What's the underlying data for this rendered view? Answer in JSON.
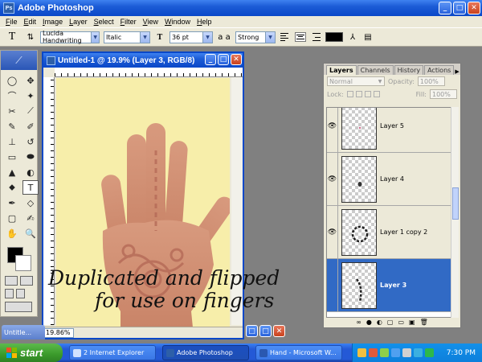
{
  "app": {
    "title": "Adobe Photoshop",
    "logo": "Ps"
  },
  "window_controls": {
    "minimize": "_",
    "restore": "□",
    "close": "✕"
  },
  "menu": [
    "File",
    "Edit",
    "Image",
    "Layer",
    "Select",
    "Filter",
    "View",
    "Window",
    "Help"
  ],
  "options_bar": {
    "tool_glyph": "T",
    "font_family": "Lucida Handwriting",
    "font_style": "Italic",
    "font_size": "36 pt",
    "aa_label": "a a",
    "antialias": "Strong",
    "color": "#000000"
  },
  "toolbox": {
    "tools": [
      "◯",
      "✥",
      "⌒",
      "✦",
      "✂",
      "⟋",
      "✎",
      "✐",
      "⊥",
      "↺",
      "▭",
      "⬬",
      "▲",
      "◐",
      "⬥",
      "T",
      "✒",
      "◇",
      "▢",
      "✍",
      "✋",
      "🔍"
    ],
    "active_tool_index": 15
  },
  "document": {
    "title": "Untitled-1 @ 19.9% (Layer 3, RGB/8)",
    "zoom": "19.86%",
    "canvas_color": "#f7eeaa"
  },
  "layers_panel": {
    "tabs": [
      "Layers",
      "Channels",
      "History",
      "Actions"
    ],
    "active_tab": "Layers",
    "blend_mode": "Normal",
    "opacity_label": "Opacity:",
    "opacity": "100%",
    "lock_label": "Lock:",
    "fill_label": "Fill:",
    "fill": "100%",
    "layers": [
      {
        "name": "Layer 5",
        "visible": true,
        "selected": false
      },
      {
        "name": "Layer 4",
        "visible": true,
        "selected": false
      },
      {
        "name": "Layer 1 copy 2",
        "visible": true,
        "selected": false
      },
      {
        "name": "Layer 3",
        "visible": false,
        "selected": true
      }
    ],
    "footer_icons": [
      "∞",
      "●",
      "◐",
      "▢",
      "▭",
      "▣",
      "🗑"
    ]
  },
  "minimized_window": {
    "title": "Untitle..."
  },
  "annotation": {
    "line1": "Duplicated and flipped",
    "line2": "for use on fingers"
  },
  "taskbar": {
    "start_label": "start",
    "items": [
      {
        "label": "2 Internet Explorer",
        "active": false
      },
      {
        "label": "Adobe Photoshop",
        "active": true
      },
      {
        "label": "Hand - Microsoft W...",
        "active": false
      }
    ],
    "clock": "7:30 PM"
  }
}
